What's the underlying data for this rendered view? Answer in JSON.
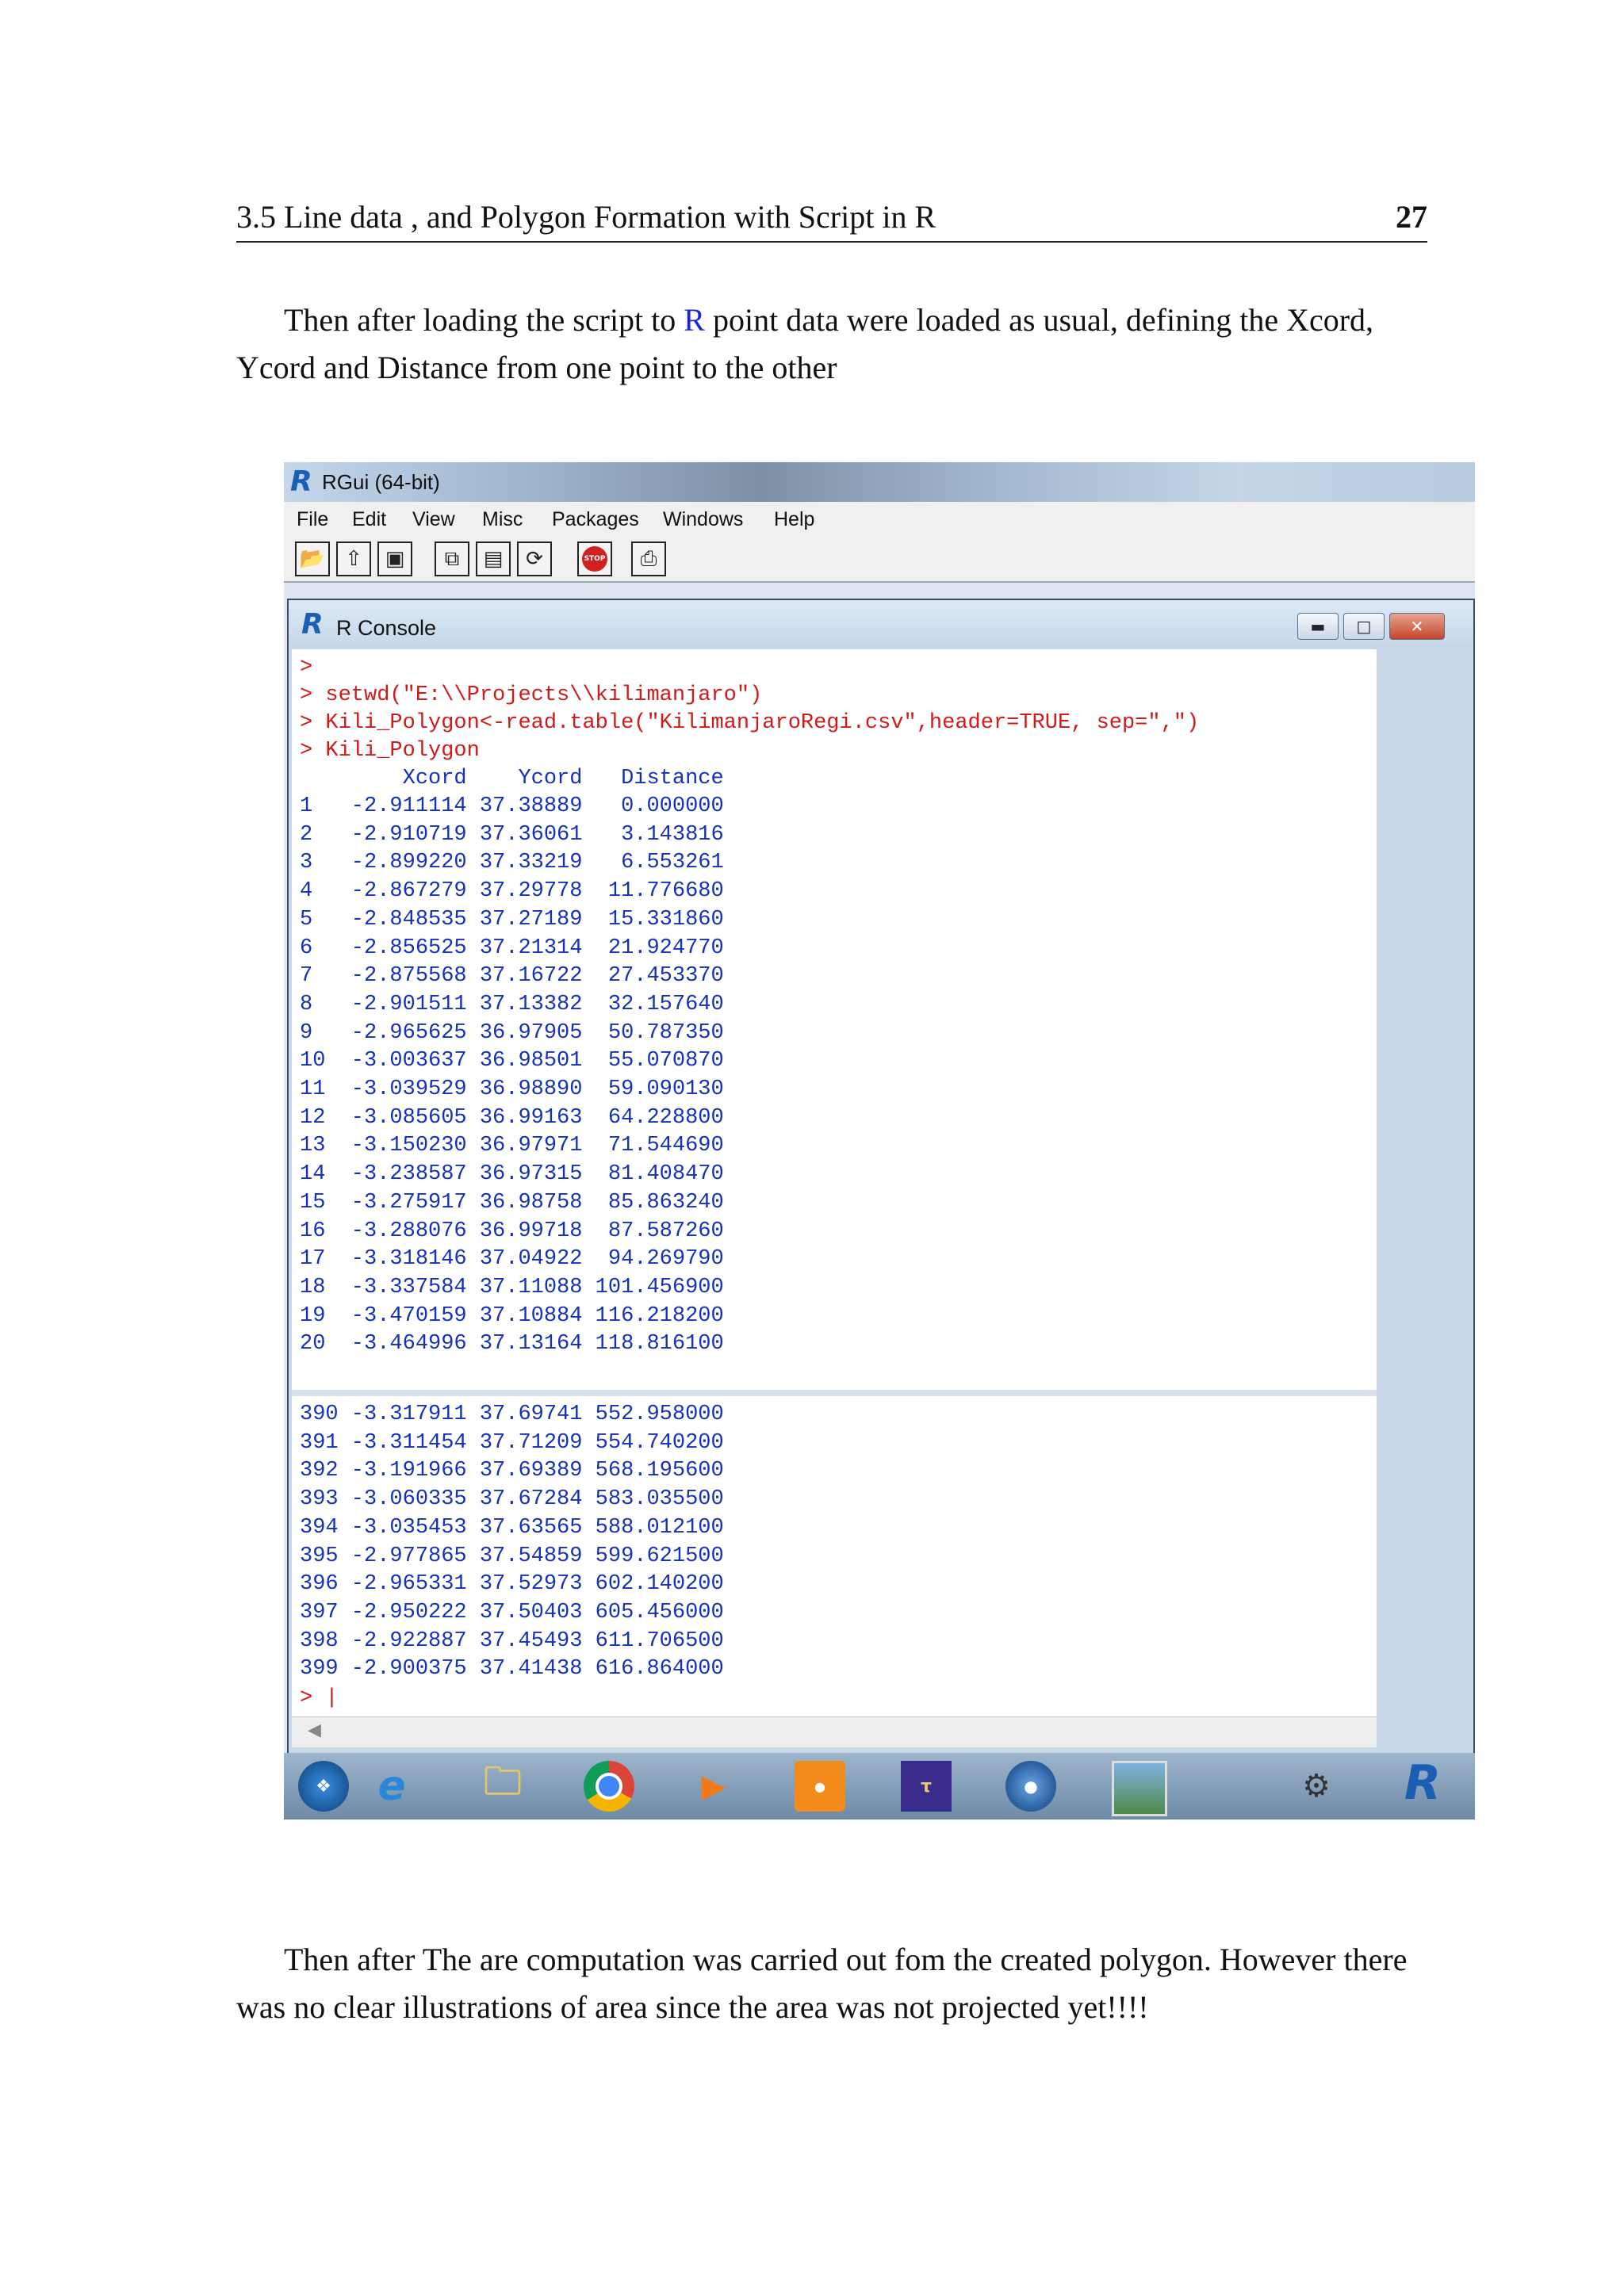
{
  "header": {
    "title": "3.5 Line data , and Polygon Formation with Script in R",
    "page_number": "27"
  },
  "para1": {
    "before": "Then after loading the script to ",
    "link": "R",
    "after": " point data were loaded as usual, defining the Xcord, Ycord and Distance from one point to the other"
  },
  "rgui": {
    "title": "RGui (64-bit)",
    "menu": [
      "File",
      "Edit",
      "View",
      "Misc",
      "Packages",
      "Windows",
      "Help"
    ],
    "toolbar_icons": [
      "open-script-icon",
      "load-workspace-icon",
      "save-icon",
      "copy-icon",
      "paste-icon",
      "refresh-icon",
      "stop-icon",
      "print-icon"
    ],
    "stop_label": "STOP",
    "console": {
      "title": "R Console",
      "commands": [
        ">",
        "> setwd(\"E:\\\\Projects\\\\kilimanjaro\")",
        "> Kili_Polygon<-read.table(\"KilimanjaroRegi.csv\",header=TRUE, sep=\",\")",
        "> Kili_Polygon"
      ],
      "table_header": "        Xcord    Ycord   Distance",
      "rows_top": [
        "1   -2.911114 37.38889   0.000000",
        "2   -2.910719 37.36061   3.143816",
        "3   -2.899220 37.33219   6.553261",
        "4   -2.867279 37.29778  11.776680",
        "5   -2.848535 37.27189  15.331860",
        "6   -2.856525 37.21314  21.924770",
        "7   -2.875568 37.16722  27.453370",
        "8   -2.901511 37.13382  32.157640",
        "9   -2.965625 36.97905  50.787350",
        "10  -3.003637 36.98501  55.070870",
        "11  -3.039529 36.98890  59.090130",
        "12  -3.085605 36.99163  64.228800",
        "13  -3.150230 36.97971  71.544690",
        "14  -3.238587 36.97315  81.408470",
        "15  -3.275917 36.98758  85.863240",
        "16  -3.288076 36.99718  87.587260",
        "17  -3.318146 37.04922  94.269790",
        "18  -3.337584 37.11088 101.456900",
        "19  -3.470159 37.10884 116.218200",
        "20  -3.464996 37.13164 118.816100"
      ],
      "rows_bottom": [
        "390 -3.317911 37.69741 552.958000",
        "391 -3.311454 37.71209 554.740200",
        "392 -3.191966 37.69389 568.195600",
        "393 -3.060335 37.67284 583.035500",
        "394 -3.035453 37.63565 588.012100",
        "395 -2.977865 37.54859 599.621500",
        "396 -2.965331 37.52973 602.140200",
        "397 -2.950222 37.50403 605.456000",
        "398 -2.922887 37.45493 611.706500",
        "399 -2.900375 37.41438 616.864000"
      ],
      "prompt": "> |"
    },
    "taskbar_icons": [
      "start-orb-icon",
      "internet-explorer-icon",
      "file-explorer-icon",
      "chrome-icon",
      "media-player-icon",
      "pdf-icon",
      "tex-icon",
      "google-earth-icon",
      "image-viewer-icon",
      "gis-tool-icon",
      "r-icon"
    ]
  },
  "para2": {
    "text": "Then after The are computation was carried out fom the created polygon. However there was no clear illustrations of area since the area was not projected yet!!!!"
  }
}
